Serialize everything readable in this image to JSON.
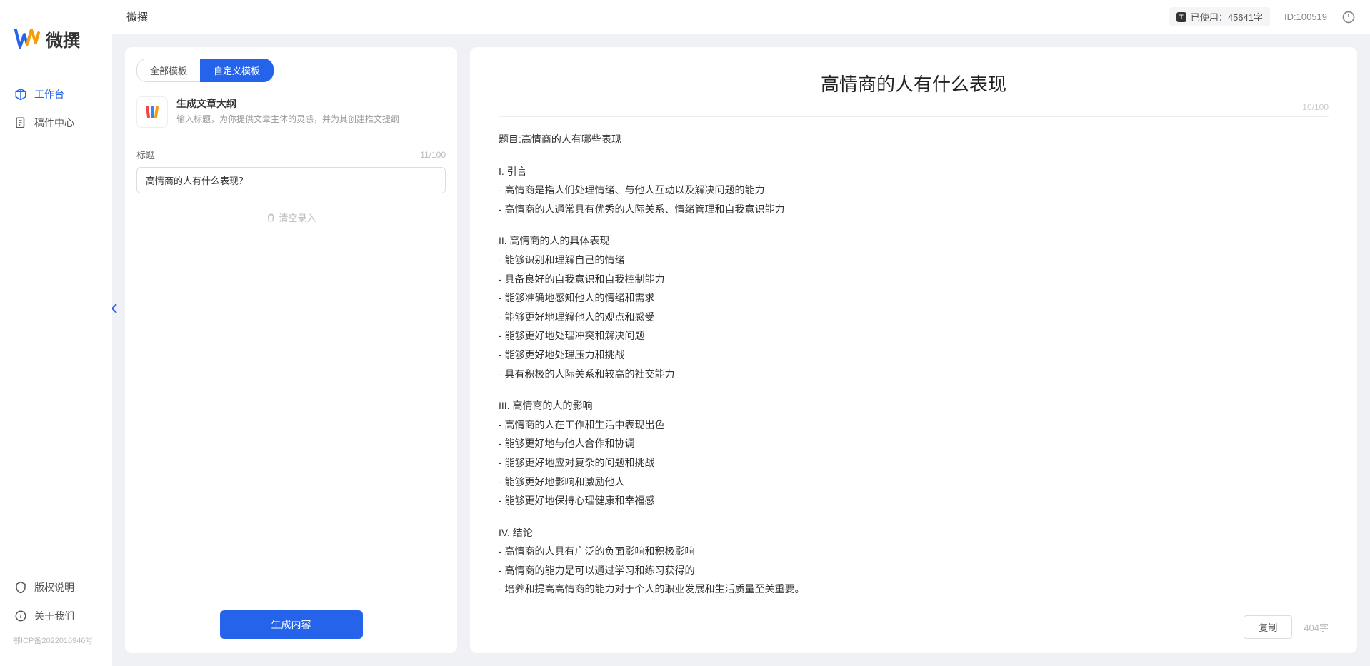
{
  "app": {
    "logo_text": "微撰",
    "topbar_title": "微撰"
  },
  "sidebar": {
    "items": [
      {
        "label": "工作台",
        "active": true
      },
      {
        "label": "稿件中心",
        "active": false
      }
    ],
    "bottom_items": [
      {
        "label": "版权说明"
      },
      {
        "label": "关于我们"
      }
    ],
    "icp": "鄂ICP备2022016946号"
  },
  "topbar": {
    "usage_label": "已使用：45641字",
    "id_label": "ID:100519"
  },
  "tabs": {
    "all": "全部模板",
    "custom": "自定义模板"
  },
  "template": {
    "title": "生成文章大纲",
    "desc": "输入标题，为你提供文章主体的灵感，并为其创建推文提纲"
  },
  "form": {
    "label": "标题",
    "char_count": "11/100",
    "input_value": "高情商的人有什么表现？",
    "clear_text": "清空录入",
    "generate_btn": "生成内容"
  },
  "output": {
    "title": "高情商的人有什么表现",
    "header_count": "10/100",
    "lines": [
      "题目:高情商的人有哪些表现",
      "",
      "I. 引言",
      "- 高情商是指人们处理情绪、与他人互动以及解决问题的能力",
      "- 高情商的人通常具有优秀的人际关系、情绪管理和自我意识能力",
      "",
      "II. 高情商的人的具体表现",
      "- 能够识别和理解自己的情绪",
      "- 具备良好的自我意识和自我控制能力",
      "- 能够准确地感知他人的情绪和需求",
      "- 能够更好地理解他人的观点和感受",
      "- 能够更好地处理冲突和解决问题",
      "- 能够更好地处理压力和挑战",
      "- 具有积极的人际关系和较高的社交能力",
      "",
      "III. 高情商的人的影响",
      "- 高情商的人在工作和生活中表现出色",
      "- 能够更好地与他人合作和协调",
      "- 能够更好地应对复杂的问题和挑战",
      "- 能够更好地影响和激励他人",
      "- 能够更好地保持心理健康和幸福感",
      "",
      "IV. 结论",
      "- 高情商的人具有广泛的负面影响和积极影响",
      "- 高情商的能力是可以通过学习和练习获得的",
      "- 培养和提高高情商的能力对于个人的职业发展和生活质量至关重要。"
    ],
    "copy_btn": "复制",
    "word_count": "404字"
  }
}
